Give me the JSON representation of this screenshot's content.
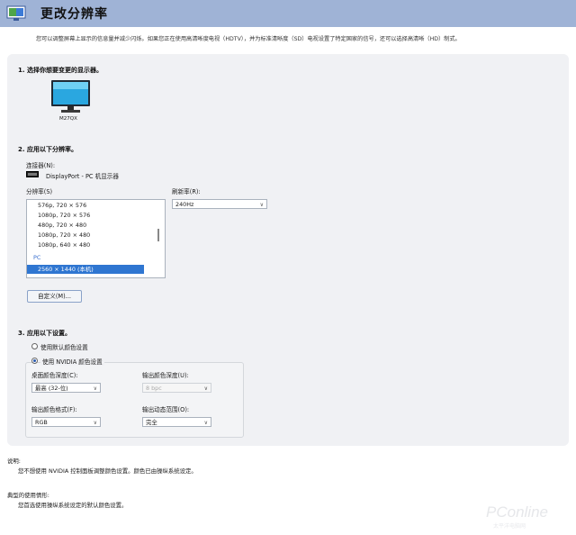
{
  "window": {
    "title": "更改分辨率"
  },
  "description": "您可以调整屏幕上显示的信息量并减少闪烁。如果您正在使用高清晰度电视（HDTV），并为标准清晰度（SD）电视设置了特定国家的信号，还可以选择高清晰（HD）制式。",
  "section1": {
    "heading": "1. 选择你想要变更的显示器。",
    "monitor_name": "M27QX"
  },
  "section2": {
    "heading": "2. 应用以下分辨率。",
    "connector_label": "连接器(N):",
    "connector_value": "DisplayPort - PC 机显示器",
    "resolution_label": "分辨率(S)",
    "refresh_label": "刷新率(R):",
    "refresh_value": "240Hz",
    "resolution_items": [
      "576p, 720 × 576",
      "1080p, 720 × 576",
      "480p, 720 × 480",
      "1080p, 720 × 480",
      "1080p, 640 × 480"
    ],
    "group_pc": "PC",
    "selected_item": "2560 × 1440 (本机)",
    "custom_button": "自定义(M)..."
  },
  "section3": {
    "heading": "3. 应用以下设置。",
    "radio_default": "使用默认颜色设置",
    "radio_nvidia": "使用 NVIDIA 颜色设置",
    "desktop_depth_label": "桌面颜色深度(C):",
    "desktop_depth_value": "最高 (32-位)",
    "output_depth_label": "输出颜色深度(U):",
    "output_depth_value": "8 bpc",
    "output_format_label": "输出颜色格式(F):",
    "output_format_value": "RGB",
    "dynamic_range_label": "输出动态范围(O):",
    "dynamic_range_value": "完全"
  },
  "notes": {
    "explain_title": "说明:",
    "explain_text": "您不想使用 NVIDIA 控制面板调整颜色设置。颜色已由操纵系统设定。",
    "typical_title": "典型的使用情形:",
    "typical_text": "您首选使用操纵系统设定的默认颜色设置。"
  },
  "watermark": {
    "brand": "PConline",
    "sub": "太平洋电脑网"
  },
  "colors": {
    "header": "#9fb3d6",
    "selection": "#2f76d1",
    "panel": "#f0f1f4"
  }
}
